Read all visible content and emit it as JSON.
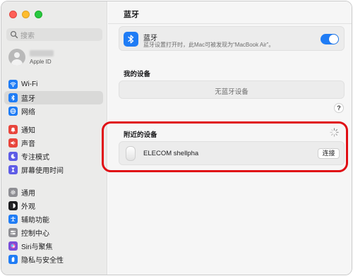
{
  "colors": {
    "accent": "#1f7cf5",
    "highlight": "#e00e14",
    "traffic_close": "#fe5f57",
    "traffic_minimize": "#febc2e",
    "traffic_zoom": "#28c840"
  },
  "sidebar": {
    "search_placeholder": "搜索",
    "account": {
      "name": "",
      "subtitle": "Apple ID"
    },
    "groups": [
      [
        {
          "label": "Wi-Fi",
          "icon": "wifi-icon",
          "color": "#1f7cf5",
          "active": false
        },
        {
          "label": "蓝牙",
          "icon": "bluetooth-icon",
          "color": "#1f7cf5",
          "active": true
        },
        {
          "label": "网络",
          "icon": "globe-icon",
          "color": "#1f7cf5",
          "active": false
        }
      ],
      [
        {
          "label": "通知",
          "icon": "bell-icon",
          "color": "#e8453c",
          "active": false
        },
        {
          "label": "声音",
          "icon": "speaker-icon",
          "color": "#e8453c",
          "active": false
        },
        {
          "label": "专注模式",
          "icon": "moon-icon",
          "color": "#5e5ce6",
          "active": false
        },
        {
          "label": "屏幕使用时间",
          "icon": "hourglass-icon",
          "color": "#5e5ce6",
          "active": false
        }
      ],
      [
        {
          "label": "通用",
          "icon": "gear-icon",
          "color": "#8e8e93",
          "active": false
        },
        {
          "label": "外观",
          "icon": "appearance-icon",
          "color": "#1d1d1f",
          "active": false
        },
        {
          "label": "辅助功能",
          "icon": "accessibility-icon",
          "color": "#1f7cf5",
          "active": false
        },
        {
          "label": "控制中心",
          "icon": "control-center-icon",
          "color": "#8e8e93",
          "active": false
        },
        {
          "label": "Siri与聚焦",
          "icon": "siri-icon",
          "color": "#7a4dd8",
          "active": false
        },
        {
          "label": "隐私与安全性",
          "icon": "hand-icon",
          "color": "#1f7cf5",
          "active": false
        }
      ]
    ]
  },
  "main": {
    "title": "蓝牙",
    "bluetooth": {
      "title": "蓝牙",
      "description": "蓝牙设置打开时，此Mac可被发现为“MacBook Air”。",
      "enabled": true
    },
    "my_devices": {
      "label": "我的设备",
      "empty_text": "无蓝牙设备"
    },
    "help_label": "?",
    "nearby": {
      "label": "附近的设备",
      "devices": [
        {
          "name": "ELECOM shellpha",
          "action": "连接"
        }
      ]
    }
  }
}
